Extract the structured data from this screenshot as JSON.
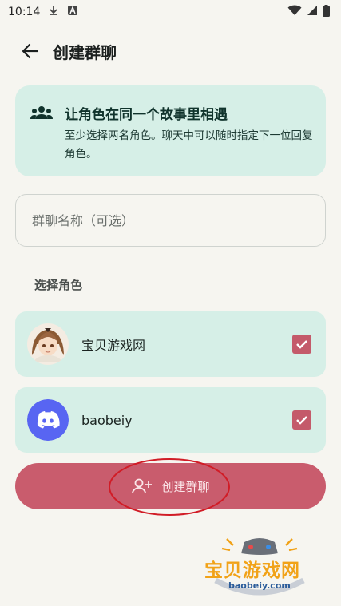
{
  "status_bar": {
    "time": "10:14",
    "battery": "full"
  },
  "header": {
    "title": "创建群聊"
  },
  "info_card": {
    "title": "让角色在同一个故事里相遇",
    "description": "至少选择两名角色。聊天中可以随时指定下一位回复角色。"
  },
  "group_name_field": {
    "placeholder": "群聊名称（可选）",
    "value": ""
  },
  "select_section": {
    "label": "选择角色",
    "characters": [
      {
        "name": "宝贝游戏网",
        "avatar": "anime-girl-avatar",
        "checked": true
      },
      {
        "name": "baobeiy",
        "avatar": "discord-logo-avatar",
        "checked": true
      }
    ]
  },
  "create_button": {
    "label": "创建群聊",
    "icon": "add-person-icon"
  },
  "watermark": {
    "text": "宝贝游戏网",
    "url": "baobeiy.com"
  },
  "colors": {
    "background": "#f6f5f0",
    "card": "#d6efe7",
    "accent": "#c95c6d",
    "annotation": "#d11c26"
  }
}
